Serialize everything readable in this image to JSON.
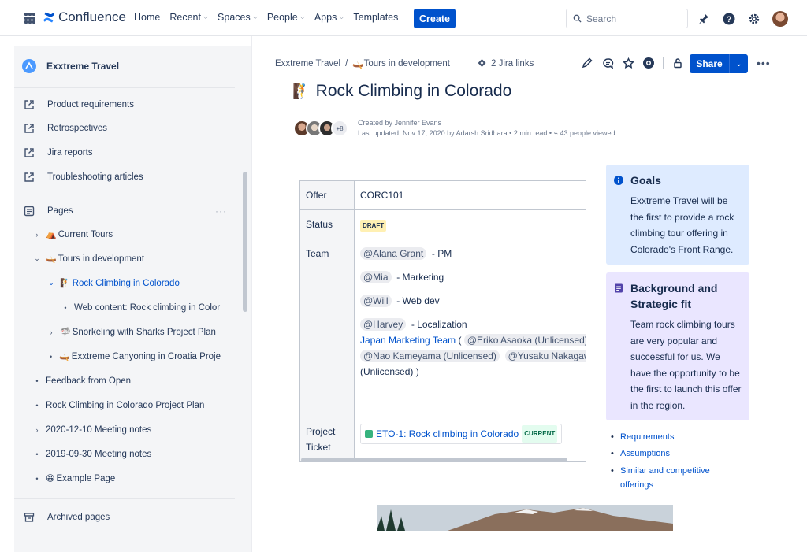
{
  "topnav": {
    "brand": "Confluence",
    "links": [
      "Home",
      "Recent",
      "Spaces",
      "People",
      "Apps",
      "Templates"
    ],
    "create_label": "Create",
    "search_placeholder": "Search"
  },
  "sidebar": {
    "space_name": "Exxtreme Travel",
    "shortcuts": [
      "Product requirements",
      "Retrospectives",
      "Jira reports",
      "Troubleshooting articles"
    ],
    "pages_label": "Pages",
    "tree": [
      {
        "label": "Current Tours",
        "emoji": "⛺"
      },
      {
        "label": "Tours in development",
        "emoji": "🛶"
      },
      {
        "label": "Rock Climbing in Colorado",
        "emoji": "🧗"
      },
      {
        "label": "Web content: Rock climbing in Color"
      },
      {
        "label": "Snorkeling with Sharks Project Plan",
        "emoji": "🦈"
      },
      {
        "label": "Exxtreme Canyoning in Croatia Proje",
        "emoji": "🛶"
      },
      {
        "label": "Feedback from Open"
      },
      {
        "label": "Rock Climbing in Colorado Project Plan"
      },
      {
        "label": "2020-12-10 Meeting notes"
      },
      {
        "label": "2019-09-30 Meeting notes"
      },
      {
        "label": "Example Page",
        "emoji": "😀"
      }
    ],
    "archived_label": "Archived pages"
  },
  "page": {
    "breadcrumb": [
      "Exxtreme Travel",
      "Tours in development"
    ],
    "breadcrumb_sep": "/",
    "jira_links": "2 Jira links",
    "share_label": "Share",
    "title": "Rock Climbing in Colorado",
    "title_emoji": "🧗",
    "avatar_more": "+8",
    "created_by": "Created by Jennifer Evans",
    "last_updated": "Last updated: Nov 17, 2020 by Adarsh Sridhara",
    "read_time": "2 min read",
    "views": "43 people viewed"
  },
  "table": {
    "rows": [
      {
        "key": "Offer",
        "value": "CORC101"
      },
      {
        "key": "Status",
        "value": "DRAFT"
      },
      {
        "key": "Team"
      },
      {
        "key": "Project Ticket"
      }
    ],
    "team": [
      {
        "mention": "@Alana Grant",
        "role": "- PM"
      },
      {
        "mention": "@Mia",
        "role": "- Marketing"
      },
      {
        "mention": "@Will",
        "role": "- Web dev"
      },
      {
        "mention": "@Harvey",
        "role": "- Localization"
      }
    ],
    "japan_team": "Japan Marketing Team",
    "japan_members": [
      "@Eriko Asaoka (Unlicensed)",
      "@Nao Kameyama (Unlicensed)",
      "@Yusaku Nakagawa"
    ],
    "japan_tail": "(Unlicensed) )",
    "ticket_label": "ETO-1: Rock climbing in Colorado",
    "ticket_status": "CURRENT"
  },
  "panels": {
    "goals_title": "Goals",
    "goals_text": "Exxtreme Travel will be the first to provide a rock climbing tour offering in Colorado's Front Range.",
    "bg_title": "Background and Strategic fit",
    "bg_text": "Team rock climbing tours are very popular and successful for us. We have the opportunity to be the first to launch this offer in the region."
  },
  "links": [
    "Requirements",
    "Assumptions",
    "Similar and competitive offerings"
  ],
  "colors": {
    "primary": "#0052cc",
    "goals_panel": "#deebff",
    "bg_panel": "#eae6ff",
    "draft_lozenge": "#fff0b3"
  }
}
